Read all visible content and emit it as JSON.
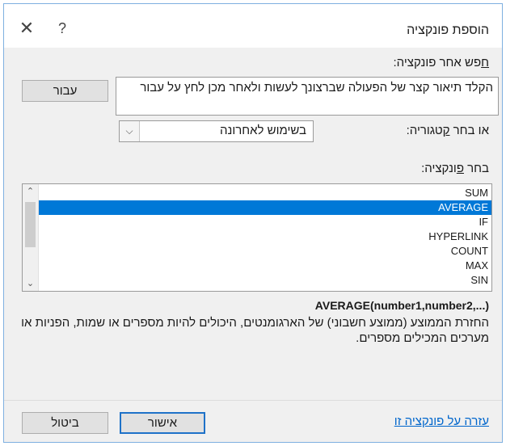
{
  "dialog": {
    "title": "הוספת פונקציה",
    "close_glyph": "✕",
    "help_glyph": "?"
  },
  "search": {
    "label": "חפש אחר פונקציה:",
    "input_value": "הקלד תיאור קצר של הפעולה שברצונך לעשות ולאחר מכן לחץ על עבור",
    "go_button": "עבור"
  },
  "category": {
    "label": "או בחר קטגוריה:",
    "selected": "בשימוש לאחרונה"
  },
  "function_list": {
    "label": "בחר פונקציה:",
    "items": [
      "SUM",
      "AVERAGE",
      "IF",
      "HYPERLINK",
      "COUNT",
      "MAX",
      "SIN"
    ],
    "selected_index": 1
  },
  "details": {
    "signature": "AVERAGE(number1,number2,...)",
    "description": "החזרת הממוצע (ממוצע חשבוני) של הארגומנטים, היכולים להיות מספרים או שמות, הפניות או מערכים המכילים מספרים."
  },
  "footer": {
    "help_link": "עזרה על פונקציה זו",
    "ok_button": "אישור",
    "cancel_button": "ביטול"
  },
  "colors": {
    "selection": "#0078d7",
    "link": "#0066cc",
    "window_border": "#7fb0e0"
  },
  "icons": {
    "close": "close-icon",
    "help": "help-icon",
    "dropdown": "chevron-down-icon",
    "scroll_up": "chevron-up-icon",
    "scroll_down": "chevron-down-icon"
  }
}
